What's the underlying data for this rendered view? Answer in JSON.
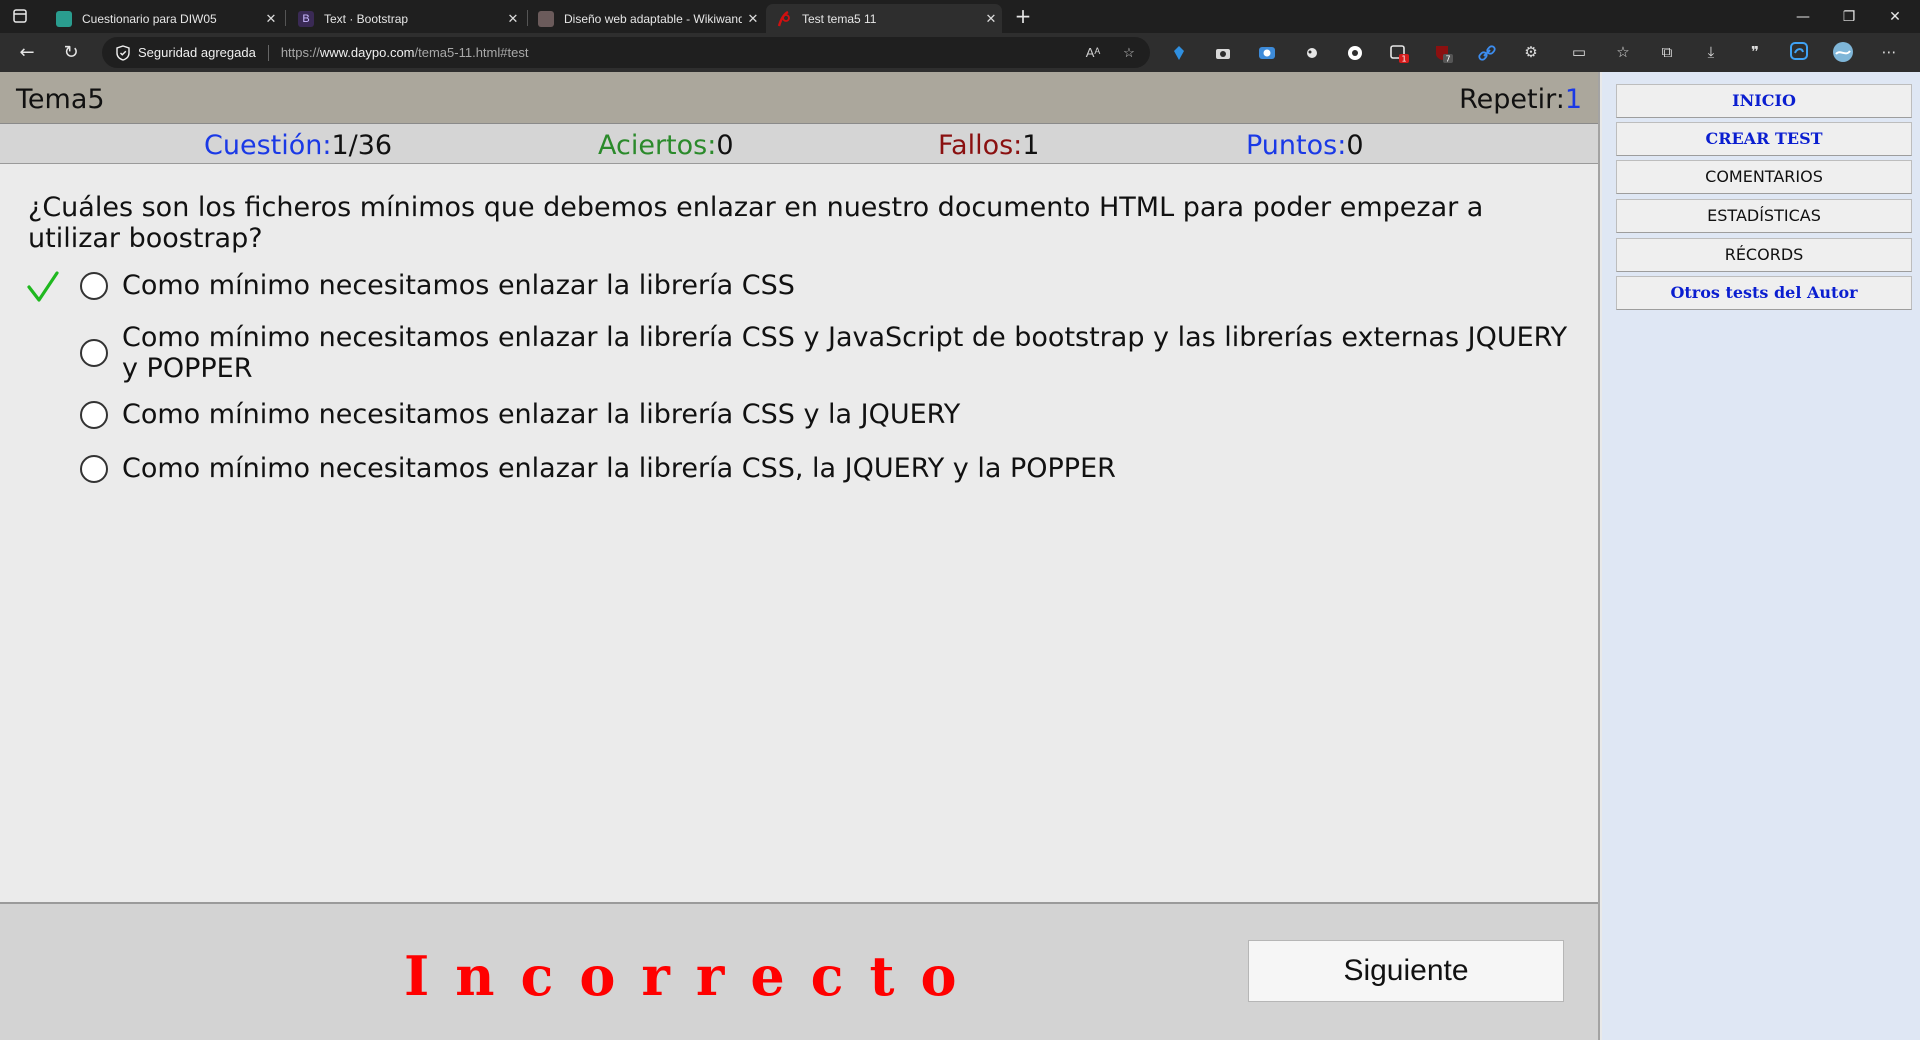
{
  "browser": {
    "tabs": [
      {
        "label": "Cuestionario para DIW05",
        "favicon_color": "#2a9d8f"
      },
      {
        "label": "Text · Bootstrap",
        "favicon_color": "#3a2a55",
        "favicon_glyph": "B"
      },
      {
        "label": "Diseño web adaptable - Wikiwand",
        "favicon_color": "#6b5b5b"
      },
      {
        "label": "Test tema5 11",
        "favicon_color": "#d01010"
      }
    ],
    "security_label": "Seguridad agregada",
    "url_prefix": "https://",
    "url_host": "www.daypo.com",
    "url_path": "/tema5-11.html#test",
    "extension_badges": [
      "1",
      "7"
    ]
  },
  "header": {
    "title": "Tema5",
    "repeat_label": "Repetir:",
    "repeat_value": "1"
  },
  "stats": {
    "question_label": "Cuestión:",
    "question_value": "1/36",
    "correct_label": "Aciertos:",
    "correct_value": "0",
    "wrong_label": "Fallos:",
    "wrong_value": "1",
    "points_label": "Puntos:",
    "points_value": "0"
  },
  "question": {
    "text": "¿Cuáles son los ficheros mínimos que debemos enlazar en nuestro documento HTML para poder empezar a utilizar boostrap?",
    "options": [
      {
        "text": "Como mínimo necesitamos enlazar la librería CSS",
        "correct": true
      },
      {
        "text": "Como mínimo necesitamos enlazar la librería CSS y JavaScript de bootstrap y las librerías externas JQUERY y POPPER",
        "correct": false
      },
      {
        "text": "Como mínimo necesitamos enlazar la librería CSS y la JQUERY",
        "correct": false
      },
      {
        "text": "Como mínimo necesitamos enlazar la librería CSS, la JQUERY y la POPPER",
        "correct": false
      }
    ]
  },
  "footer": {
    "result_text": "Incorrecto",
    "result_color": "#ff0000",
    "next_label": "Siguiente"
  },
  "sidebar": {
    "items": [
      {
        "label": "INICIO"
      },
      {
        "label": "CREAR TEST"
      },
      {
        "label": "COMENTARIOS"
      },
      {
        "label": "ESTADÍSTICAS"
      },
      {
        "label": "RÉCORDS"
      },
      {
        "label": "Otros tests del Autor"
      }
    ]
  },
  "colors": {
    "label_blue": "#1a39e6",
    "label_green": "#2b8a2b",
    "label_red": "#8a1010",
    "sidebar_link_blue": "#0a1ed0",
    "check_green": "#1fb81f"
  }
}
